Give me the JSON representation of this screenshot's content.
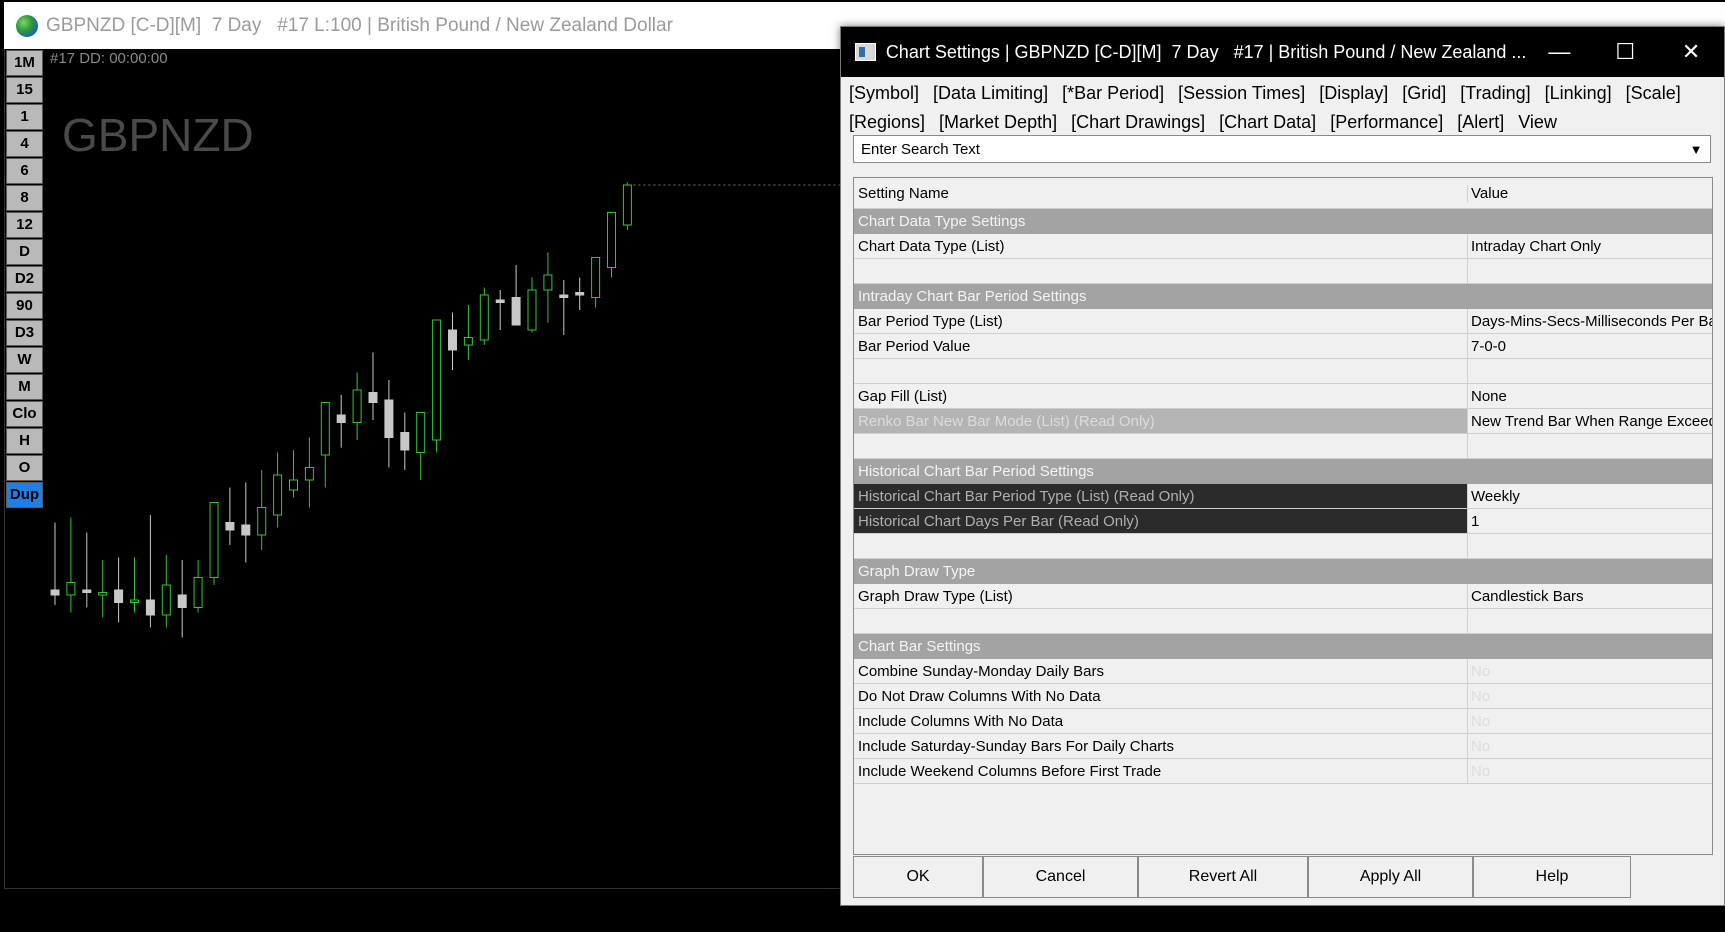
{
  "chart_window": {
    "title": "GBPNZD [C-D][M]  7 Day   #17 L:100 | British Pound / New Zealand Dollar",
    "dd_label": "#17 DD: 00:00:00",
    "symbol_watermark": "GBPNZD",
    "period_buttons": [
      "1M",
      "15",
      "1",
      "4",
      "6",
      "8",
      "12",
      "D",
      "D2",
      "90",
      "D3",
      "W",
      "M",
      "Clo",
      "H",
      "O",
      "Dup"
    ],
    "active_button": "Dup"
  },
  "chart_data": {
    "type": "candlestick",
    "colors": {
      "up": "#32c832",
      "down": "#c8c8c8",
      "last_price_line": "#777777"
    },
    "candles": [
      {
        "o": 50.0,
        "h": 63.5,
        "l": 47.0,
        "c": 49.0
      },
      {
        "o": 49.0,
        "h": 64.5,
        "l": 45.5,
        "c": 51.5
      },
      {
        "o": 50.0,
        "h": 61.5,
        "l": 46.5,
        "c": 49.5
      },
      {
        "o": 49.0,
        "h": 56.0,
        "l": 44.5,
        "c": 49.5
      },
      {
        "o": 50.0,
        "h": 56.5,
        "l": 43.5,
        "c": 47.5
      },
      {
        "o": 47.5,
        "h": 56.5,
        "l": 45.5,
        "c": 48.0
      },
      {
        "o": 48.0,
        "h": 65.0,
        "l": 42.5,
        "c": 45.0
      },
      {
        "o": 45.0,
        "h": 57.0,
        "l": 42.5,
        "c": 51.0
      },
      {
        "o": 49.0,
        "h": 56.0,
        "l": 40.5,
        "c": 46.5
      },
      {
        "o": 46.5,
        "h": 56.0,
        "l": 45.5,
        "c": 52.5
      },
      {
        "o": 52.5,
        "h": 65.0,
        "l": 51.0,
        "c": 67.5
      },
      {
        "o": 63.5,
        "h": 70.5,
        "l": 59.0,
        "c": 62.0
      },
      {
        "o": 63.0,
        "h": 71.5,
        "l": 55.5,
        "c": 61.0
      },
      {
        "o": 61.0,
        "h": 74.0,
        "l": 58.0,
        "c": 66.5
      },
      {
        "o": 65.0,
        "h": 77.5,
        "l": 62.5,
        "c": 73.0
      },
      {
        "o": 70.0,
        "h": 78.0,
        "l": 68.5,
        "c": 72.0
      },
      {
        "o": 72.0,
        "h": 80.5,
        "l": 66.5,
        "c": 74.5
      },
      {
        "o": 77.0,
        "h": 83.5,
        "l": 70.5,
        "c": 87.5
      },
      {
        "o": 85.0,
        "h": 89.0,
        "l": 78.5,
        "c": 83.5
      },
      {
        "o": 83.5,
        "h": 93.5,
        "l": 80.0,
        "c": 90.0
      },
      {
        "o": 89.5,
        "h": 97.5,
        "l": 84.0,
        "c": 87.5
      },
      {
        "o": 88.0,
        "h": 92.0,
        "l": 74.5,
        "c": 80.5
      },
      {
        "o": 81.5,
        "h": 85.5,
        "l": 74.0,
        "c": 78.0
      },
      {
        "o": 77.5,
        "h": 84.5,
        "l": 72.0,
        "c": 85.5
      },
      {
        "o": 80.0,
        "h": 98.0,
        "l": 77.5,
        "c": 104.0
      },
      {
        "o": 102.0,
        "h": 105.5,
        "l": 94.0,
        "c": 98.0
      },
      {
        "o": 99.0,
        "h": 107.0,
        "l": 96.0,
        "c": 100.5
      },
      {
        "o": 100.0,
        "h": 110.5,
        "l": 99.0,
        "c": 109.0
      },
      {
        "o": 108.0,
        "h": 110.0,
        "l": 102.0,
        "c": 107.5
      },
      {
        "o": 108.5,
        "h": 115.0,
        "l": 103.0,
        "c": 103.0
      },
      {
        "o": 102.0,
        "h": 112.5,
        "l": 101.5,
        "c": 110.0
      },
      {
        "o": 110.0,
        "h": 117.5,
        "l": 103.5,
        "c": 113.0
      },
      {
        "o": 109.0,
        "h": 112.0,
        "l": 101.0,
        "c": 108.5
      },
      {
        "o": 109.5,
        "h": 112.5,
        "l": 106.0,
        "c": 109.0
      },
      {
        "o": 108.5,
        "h": 116.0,
        "l": 106.5,
        "c": 116.5
      },
      {
        "o": 114.5,
        "h": 122.5,
        "l": 112.5,
        "c": 125.5
      },
      {
        "o": 123.0,
        "h": 131.5,
        "l": 122.0,
        "c": 131.0
      }
    ],
    "last_price_line": true,
    "xlabel": "",
    "ylabel": ""
  },
  "dialog": {
    "title": "Chart Settings | GBPNZD [C-D][M]  7 Day   #17 | British Pound / New Zealand ...",
    "minimize": "—",
    "maximize": "☐",
    "close": "✕",
    "menu_row1": [
      "[Symbol]",
      "[Data Limiting]",
      "[*Bar Period]",
      "[Session Times]",
      "[Display]",
      "[Grid]",
      "[Trading]",
      "[Linking]",
      "[Scale]"
    ],
    "menu_row2": [
      "[Regions]",
      "[Market Depth]",
      "[Chart Drawings]",
      "[Chart Data]",
      "[Performance]",
      "[Alert]",
      "View"
    ],
    "search_placeholder": "Enter Search Text",
    "table_headers": {
      "name": "Setting Name",
      "value": "Value"
    },
    "rows": [
      {
        "kind": "section",
        "name": "Chart Data Type Settings",
        "value": ""
      },
      {
        "kind": "normal",
        "name": "Chart Data Type (List)",
        "value": "Intraday Chart Only"
      },
      {
        "kind": "blank",
        "name": "",
        "value": ""
      },
      {
        "kind": "section",
        "name": "Intraday Chart Bar Period Settings",
        "value": ""
      },
      {
        "kind": "normal",
        "name": "Bar Period Type (List)",
        "value": "Days-Mins-Secs-Milliseconds Per Bar"
      },
      {
        "kind": "normal",
        "name": "Bar Period Value",
        "value": "7-0-0"
      },
      {
        "kind": "blank",
        "name": "",
        "value": ""
      },
      {
        "kind": "normal",
        "name": "Gap Fill (List)",
        "value": "None"
      },
      {
        "kind": "readonly-grey",
        "name": "Renko Bar New Bar Mode (List) (Read Only)",
        "value": "New Trend Bar When Range Exceeded"
      },
      {
        "kind": "blank",
        "name": "",
        "value": ""
      },
      {
        "kind": "section",
        "name": "Historical Chart Bar Period Settings",
        "value": ""
      },
      {
        "kind": "readonly-dark",
        "name": "Historical Chart Bar Period Type (List) (Read Only)",
        "value": "Weekly"
      },
      {
        "kind": "readonly-dark",
        "name": "Historical Chart Days Per Bar (Read Only)",
        "value": "1"
      },
      {
        "kind": "blank",
        "name": "",
        "value": ""
      },
      {
        "kind": "section",
        "name": "Graph Draw Type",
        "value": ""
      },
      {
        "kind": "normal",
        "name": "Graph Draw Type (List)",
        "value": "Candlestick Bars"
      },
      {
        "kind": "blank",
        "name": "",
        "value": ""
      },
      {
        "kind": "section",
        "name": "Chart Bar Settings",
        "value": ""
      },
      {
        "kind": "faded",
        "name": "Combine Sunday-Monday Daily Bars",
        "value": "No"
      },
      {
        "kind": "faded",
        "name": "Do Not Draw Columns With No Data",
        "value": "No"
      },
      {
        "kind": "faded",
        "name": "Include Columns With No Data",
        "value": "No"
      },
      {
        "kind": "faded",
        "name": "Include Saturday-Sunday Bars For Daily Charts",
        "value": "No"
      },
      {
        "kind": "faded",
        "name": "Include Weekend Columns Before First Trade",
        "value": "No"
      }
    ],
    "buttons": [
      "OK",
      "Cancel",
      "Revert All",
      "Apply All",
      "Help"
    ]
  }
}
